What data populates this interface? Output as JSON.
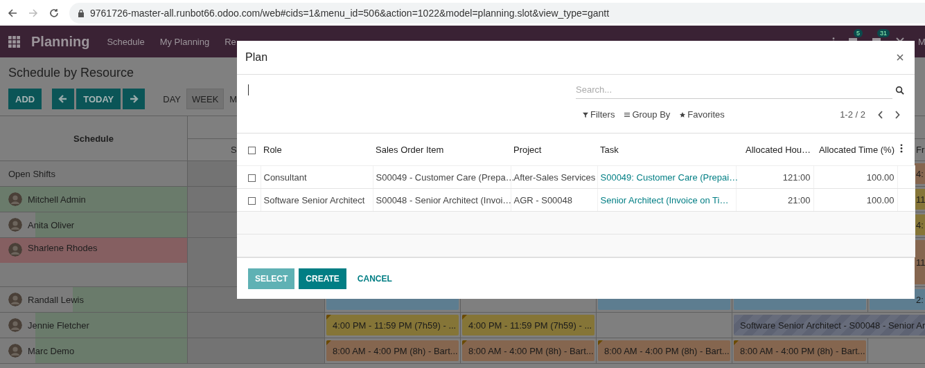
{
  "browser": {
    "url": "9761726-master-all.runbot66.odoo.com/web#cids=1&menu_id=506&action=1022&model=planning.slot&view_type=gantt",
    "forward_disabled": true
  },
  "navbar": {
    "app": "Planning",
    "menu": [
      "Schedule",
      "My Planning",
      "Re"
    ],
    "badges": [
      "5",
      "31"
    ],
    "user": "M"
  },
  "control_panel": {
    "title": "Schedule by Resource",
    "add": "ADD",
    "today": "TODAY",
    "scales": [
      {
        "label": "DAY",
        "selected": false
      },
      {
        "label": "WEEK",
        "selected": true
      },
      {
        "label": "M",
        "selected": false
      }
    ]
  },
  "gantt": {
    "header": "Schedule",
    "days": [
      "S",
      "Fr"
    ],
    "rows": [
      {
        "kind": "open",
        "name": "Open Shifts",
        "cells": [
          {
            "kind": "empty"
          },
          {
            "kind": "empty"
          },
          {
            "kind": "empty"
          },
          {
            "kind": "empty"
          },
          {
            "kind": "empty"
          },
          {
            "kind": "pill",
            "color": "#85664f",
            "text": "4:"
          }
        ]
      },
      {
        "kind": "person",
        "name": "Mitchell Admin",
        "level": 1,
        "overloaded": false,
        "tall": false,
        "cells": [
          {
            "kind": "empty"
          },
          {
            "kind": "empty"
          },
          {
            "kind": "empty"
          },
          {
            "kind": "empty"
          },
          {
            "kind": "empty"
          },
          {
            "kind": "pill",
            "color": "#857537",
            "text": "11"
          }
        ]
      },
      {
        "kind": "person",
        "name": "Anita Oliver",
        "level": 0.81,
        "overloaded": false,
        "tall": false,
        "cells": [
          {
            "kind": "empty"
          },
          {
            "kind": "empty"
          },
          {
            "kind": "empty"
          },
          {
            "kind": "empty"
          },
          {
            "kind": "empty"
          },
          {
            "kind": "pill",
            "color": "#857537",
            "text": "4:"
          }
        ]
      },
      {
        "kind": "person",
        "name": "Sharlene Rhodes",
        "level": 1,
        "overloaded": true,
        "tall": true,
        "cells": [
          {
            "kind": "empty"
          },
          {
            "kind": "empty"
          },
          {
            "kind": "empty"
          },
          {
            "kind": "empty"
          },
          {
            "kind": "empty"
          },
          {
            "kind": "pill",
            "color": "#85664f",
            "text": "11"
          }
        ]
      },
      {
        "kind": "person",
        "name": "Randall Lewis",
        "level": 0.61,
        "overloaded": false,
        "tall": false,
        "cells": [
          {
            "kind": "empty"
          },
          {
            "kind": "pill",
            "color": "#5d7d90"
          },
          {
            "kind": "empty"
          },
          {
            "kind": "pill",
            "color": "#5d7d90"
          },
          {
            "kind": "pill",
            "color": "#5d7d90"
          },
          {
            "kind": "pill",
            "color": "#5d7d90",
            "text": "2:"
          }
        ]
      },
      {
        "kind": "person",
        "name": "Jennie Fletcher",
        "level": 0.81,
        "overloaded": false,
        "tall": false,
        "cells": [
          {
            "kind": "empty"
          },
          {
            "kind": "pill",
            "color": "#857537",
            "text": "4:00 PM - 11:59 PM (7h59) - ..."
          },
          {
            "kind": "pill",
            "color": "#857537",
            "text": "4:00 PM - 11:59 PM (7h59) - ..."
          },
          {
            "kind": "empty"
          },
          {
            "kind": "striped",
            "color": "#5e6373",
            "text": "Software Senior Architect - S00048 - Senior Ar"
          }
        ]
      },
      {
        "kind": "person",
        "name": "Marc Demo",
        "level": 0.81,
        "overloaded": false,
        "tall": false,
        "cells": [
          {
            "kind": "empty"
          },
          {
            "kind": "pill",
            "color": "#85664f",
            "text": "8:00 AM - 4:00 PM (8h) - Bart..."
          },
          {
            "kind": "pill",
            "color": "#85664f",
            "text": "8:00 AM - 4:00 PM (8h) - Bart..."
          },
          {
            "kind": "pill",
            "color": "#85664f",
            "text": "8:00 AM - 4:00 PM (8h) - Bart..."
          },
          {
            "kind": "pill",
            "color": "#85664f",
            "text": "8:00 AM - 4:00 PM (8h) - Bart..."
          },
          {
            "kind": "empty"
          }
        ]
      }
    ]
  },
  "dialog": {
    "title": "Plan",
    "search": {
      "placeholder": "Search..."
    },
    "filters": [
      "Filters",
      "Group By",
      "Favorites"
    ],
    "pager": "1-2 / 2",
    "table": {
      "select_all_checked": false,
      "columns": [
        "Role",
        "Sales Order Item",
        "Project",
        "Task",
        "Allocated Hou…",
        "Allocated Time (%)"
      ],
      "rows": [
        {
          "checked": false,
          "cells": [
            "Consultant",
            "S00049 - Customer Care (Prepa…",
            "After-Sales Services",
            "S00049: Customer Care (Prepai…",
            "121:00",
            "100.00"
          ]
        },
        {
          "checked": false,
          "cells": [
            "Software Senior Architect",
            "S00048 - Senior Architect (Invoi…",
            "AGR - S00048",
            "Senior Architect (Invoice on Ti…",
            "21:00",
            "100.00"
          ]
        }
      ]
    },
    "buttons": [
      {
        "label": "SELECT",
        "disabled": true,
        "kind": "primary"
      },
      {
        "label": "CREATE",
        "disabled": false,
        "kind": "primary"
      },
      {
        "label": "CANCEL",
        "disabled": false,
        "kind": "link"
      }
    ]
  }
}
